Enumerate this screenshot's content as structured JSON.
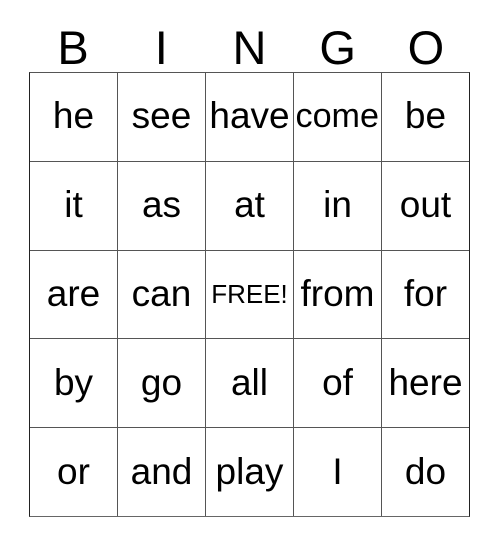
{
  "card": {
    "title": "BINGO",
    "headers": [
      "B",
      "I",
      "N",
      "G",
      "O"
    ],
    "free_space_label": "FREE!",
    "free_space_position": {
      "row": 2,
      "col": 2
    },
    "colors": {
      "background": "#ffffff",
      "text": "#000000",
      "grid_line": "#555555",
      "grid_border": "#222222"
    },
    "rows": [
      {
        "cells": [
          {
            "text": "he",
            "free": false
          },
          {
            "text": "see",
            "free": false
          },
          {
            "text": "have",
            "free": false
          },
          {
            "text": "come",
            "free": false
          },
          {
            "text": "be",
            "free": false
          }
        ]
      },
      {
        "cells": [
          {
            "text": "it",
            "free": false
          },
          {
            "text": "as",
            "free": false
          },
          {
            "text": "at",
            "free": false
          },
          {
            "text": "in",
            "free": false
          },
          {
            "text": "out",
            "free": false
          }
        ]
      },
      {
        "cells": [
          {
            "text": "are",
            "free": false
          },
          {
            "text": "can",
            "free": false
          },
          {
            "text": "FREE!",
            "free": true
          },
          {
            "text": "from",
            "free": false
          },
          {
            "text": "for",
            "free": false
          }
        ]
      },
      {
        "cells": [
          {
            "text": "by",
            "free": false
          },
          {
            "text": "go",
            "free": false
          },
          {
            "text": "all",
            "free": false
          },
          {
            "text": "of",
            "free": false
          },
          {
            "text": "here",
            "free": false
          }
        ]
      },
      {
        "cells": [
          {
            "text": "or",
            "free": false
          },
          {
            "text": "and",
            "free": false
          },
          {
            "text": "play",
            "free": false
          },
          {
            "text": "I",
            "free": false
          },
          {
            "text": "do",
            "free": false
          }
        ]
      }
    ]
  }
}
